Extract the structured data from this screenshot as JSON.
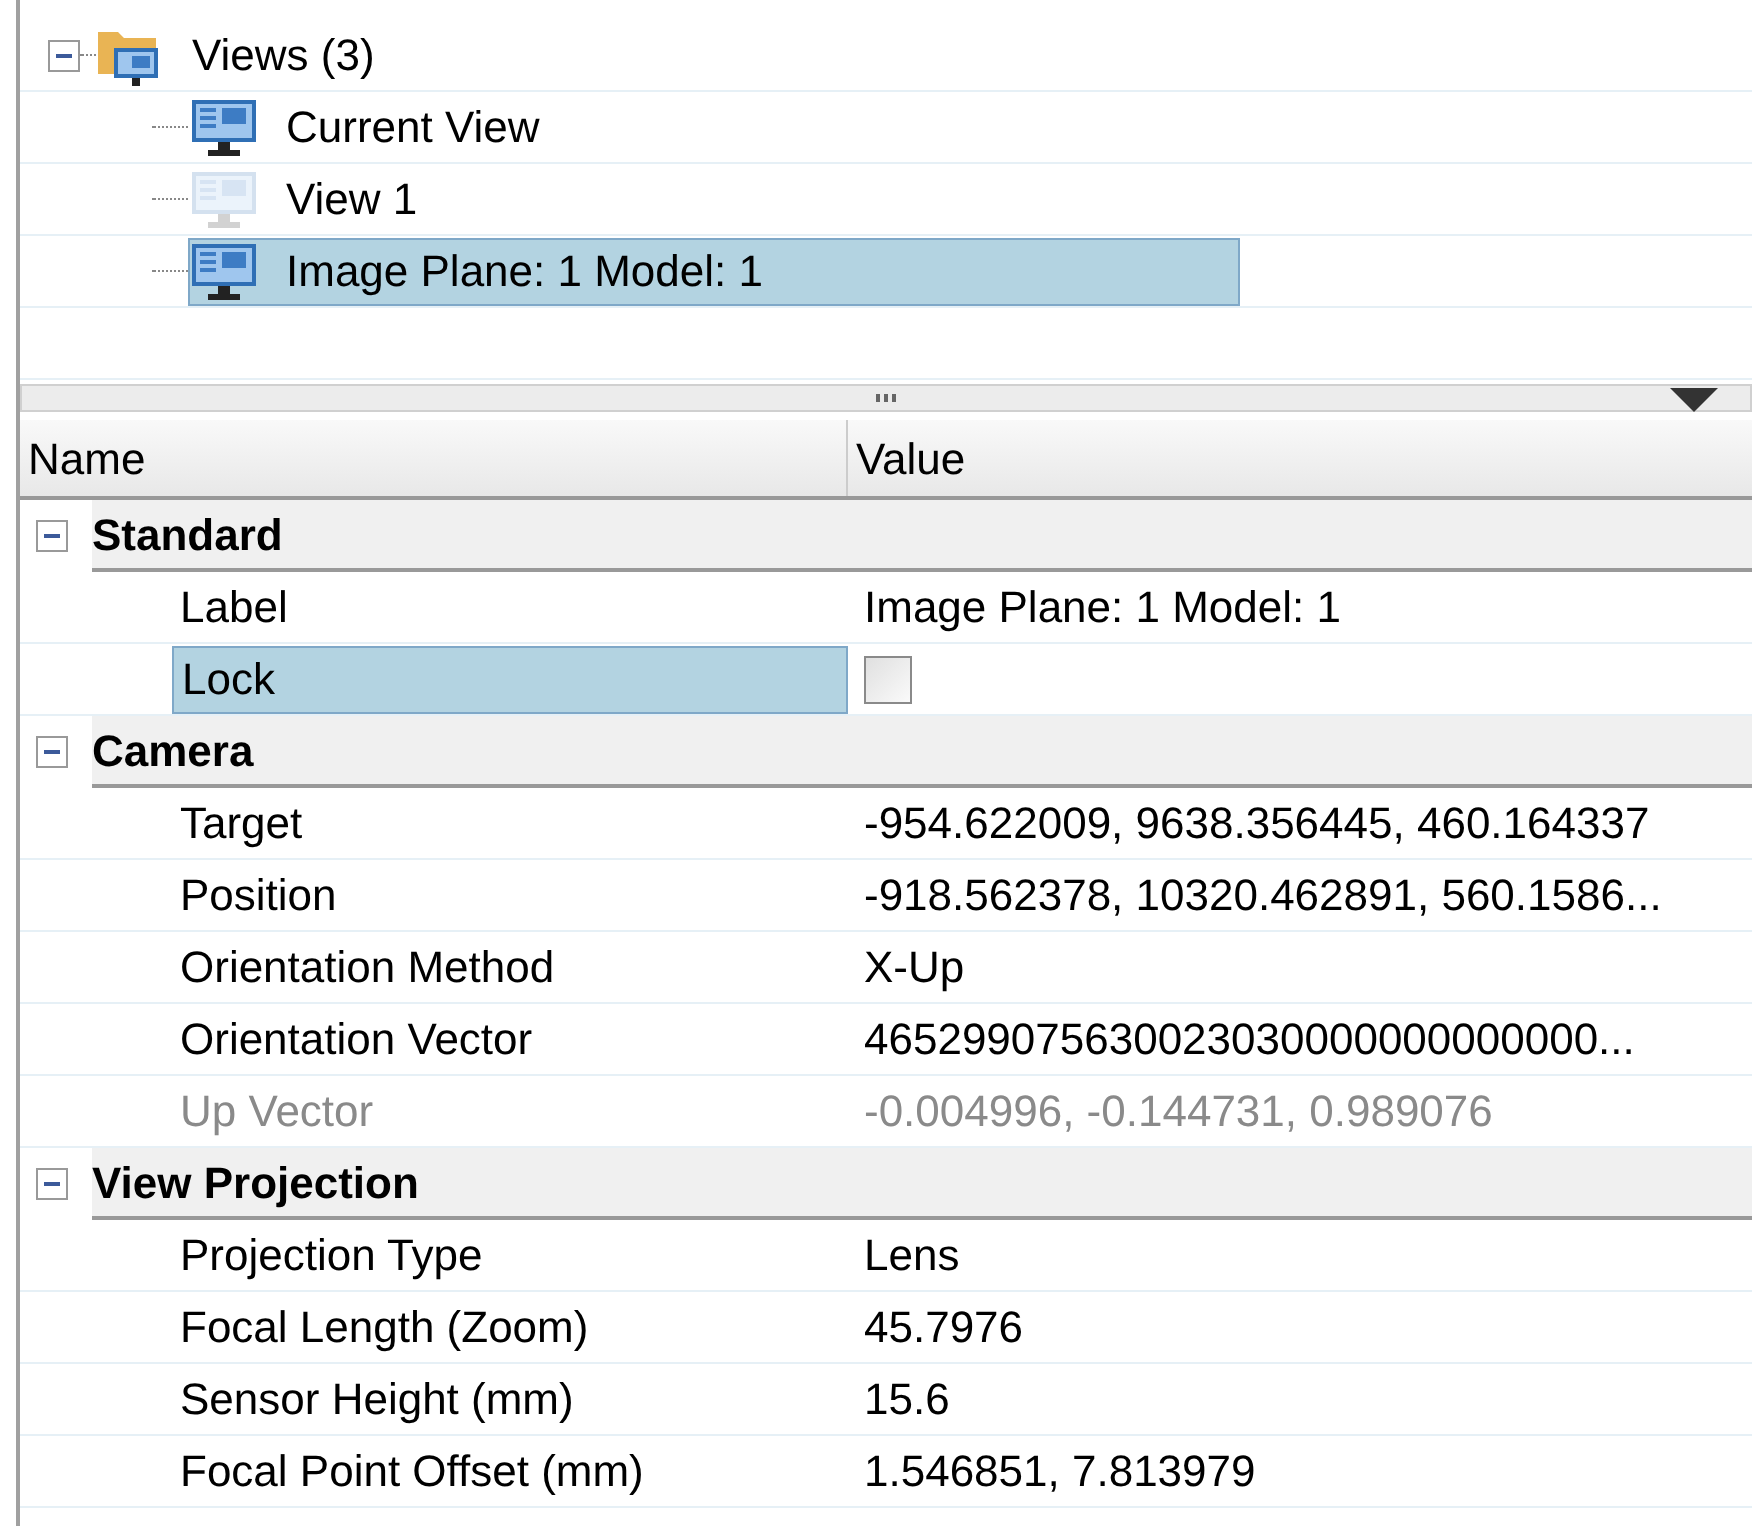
{
  "tree": {
    "label": "Views (3)",
    "expanded": true,
    "children": [
      {
        "label": "Current View",
        "selected": false,
        "disabled": false
      },
      {
        "label": "View 1",
        "selected": false,
        "disabled": true
      },
      {
        "label": "Image Plane: 1 Model: 1",
        "selected": true,
        "disabled": false
      }
    ]
  },
  "grid": {
    "columns": [
      "Name",
      "Value"
    ],
    "categories": [
      {
        "label": "Standard",
        "expanded": true,
        "properties": [
          {
            "kind": "text",
            "name": "Label",
            "value": "Image Plane: 1 Model: 1",
            "selected": false,
            "disabled": false
          },
          {
            "kind": "checkbox",
            "name": "Lock",
            "checked": false,
            "selected": true,
            "disabled": false
          }
        ]
      },
      {
        "label": "Camera",
        "expanded": true,
        "properties": [
          {
            "kind": "text",
            "name": "Target",
            "value": "-954.622009, 9638.356445, 460.164337",
            "selected": false,
            "disabled": false
          },
          {
            "kind": "text",
            "name": "Position",
            "value": "-918.562378, 10320.462891, 560.1586...",
            "selected": false,
            "disabled": false
          },
          {
            "kind": "text",
            "name": "Orientation Method",
            "value": "X-Up",
            "selected": false,
            "disabled": false
          },
          {
            "kind": "text",
            "name": "Orientation Vector",
            "value": "465299075630023030000000000000...",
            "selected": false,
            "disabled": false
          },
          {
            "kind": "text",
            "name": "Up Vector",
            "value": "-0.004996, -0.144731, 0.989076",
            "selected": false,
            "disabled": true
          }
        ]
      },
      {
        "label": "View Projection",
        "expanded": true,
        "properties": [
          {
            "kind": "text",
            "name": "Projection Type",
            "value": "Lens",
            "selected": false,
            "disabled": false
          },
          {
            "kind": "text",
            "name": "Focal Length (Zoom)",
            "value": "45.7976",
            "selected": false,
            "disabled": false
          },
          {
            "kind": "text",
            "name": "Sensor Height (mm)",
            "value": "15.6",
            "selected": false,
            "disabled": false
          },
          {
            "kind": "text",
            "name": "Focal Point Offset (mm)",
            "value": "1.546851, 7.813979",
            "selected": false,
            "disabled": false
          }
        ]
      }
    ]
  }
}
